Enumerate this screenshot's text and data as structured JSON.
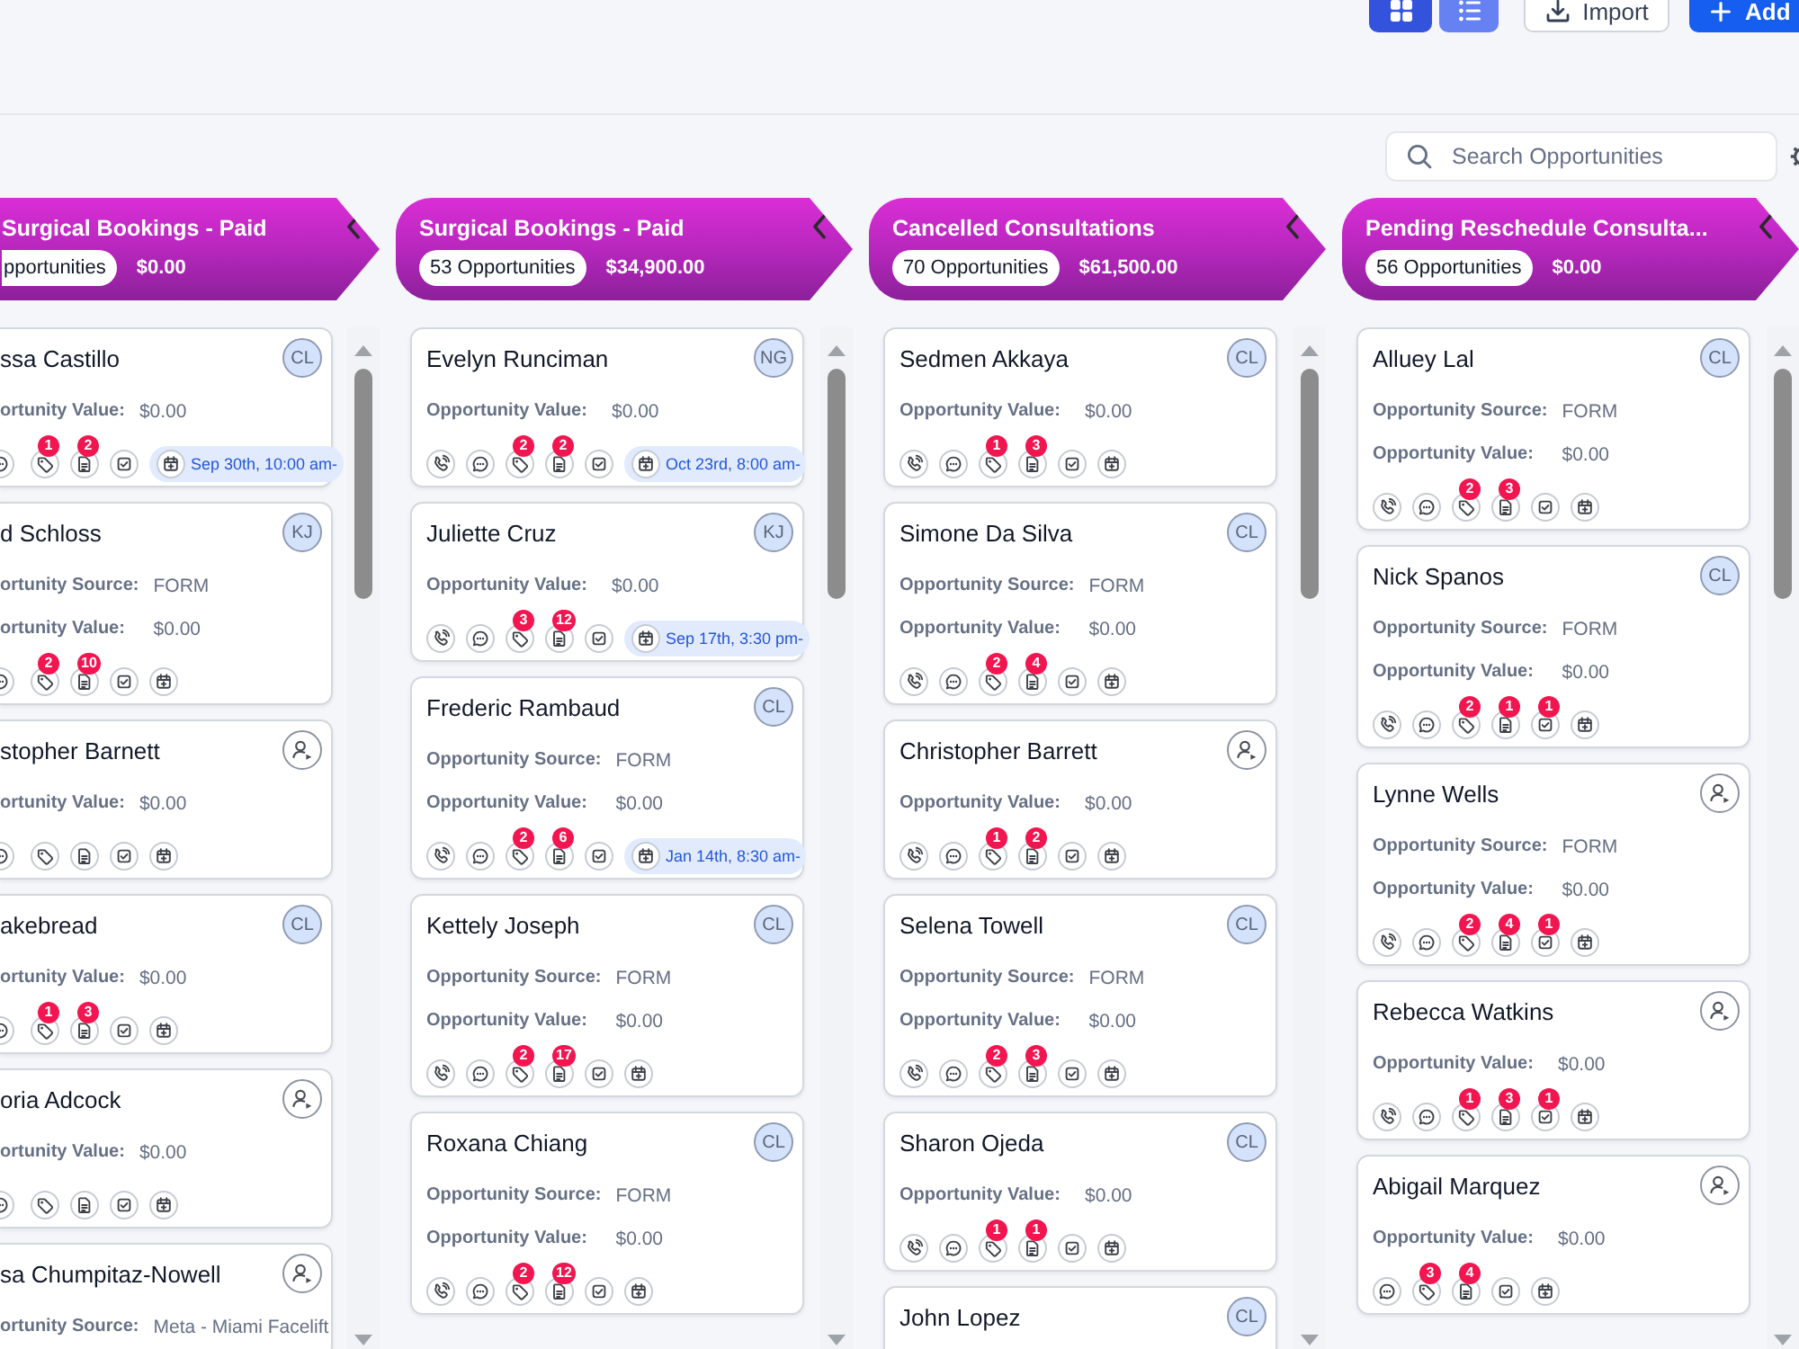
{
  "toolbar": {
    "view_toggle": [
      {
        "kind": "grid",
        "selected": true
      },
      {
        "kind": "list",
        "selected": false
      }
    ],
    "import_button": "Import",
    "add_button": "Add"
  },
  "search": {
    "placeholder": "Search Opportunities"
  },
  "stages": [
    {
      "title": "Surgical Bookings - Paid",
      "count": "pportunities",
      "total": "$0.00",
      "cards": [
        {
          "name": "ssa Castillo",
          "avatar": {
            "kind": "initials",
            "text": "CL"
          },
          "fields": [
            {
              "label": "ortunity Value:",
              "value": "$0.00"
            }
          ],
          "actions": [
            {
              "kind": "chat"
            },
            {
              "kind": "tag",
              "count": "1"
            },
            {
              "kind": "note",
              "count": "2"
            },
            {
              "kind": "task"
            },
            {
              "kind": "appointment",
              "date": "Sep 30th, 10:00 am-"
            }
          ]
        },
        {
          "name": "d Schloss",
          "avatar": {
            "kind": "initials",
            "text": "KJ"
          },
          "fields": [
            {
              "label": "ortunity Source:",
              "value": "FORM"
            },
            {
              "label": "ortunity Value:",
              "value": "$0.00"
            }
          ],
          "actions": [
            {
              "kind": "chat"
            },
            {
              "kind": "tag",
              "count": "2"
            },
            {
              "kind": "note",
              "count": "10"
            },
            {
              "kind": "task"
            },
            {
              "kind": "appointment"
            }
          ]
        },
        {
          "name": "stopher Barnett",
          "avatar": {
            "kind": "unassigned"
          },
          "fields": [
            {
              "label": "ortunity Value:",
              "value": "$0.00"
            }
          ],
          "actions": [
            {
              "kind": "chat"
            },
            {
              "kind": "tag"
            },
            {
              "kind": "note"
            },
            {
              "kind": "task"
            },
            {
              "kind": "appointment"
            }
          ]
        },
        {
          "name": "akebread",
          "avatar": {
            "kind": "initials",
            "text": "CL"
          },
          "fields": [
            {
              "label": "ortunity Value:",
              "value": "$0.00"
            }
          ],
          "actions": [
            {
              "kind": "chat"
            },
            {
              "kind": "tag",
              "count": "1"
            },
            {
              "kind": "note",
              "count": "3"
            },
            {
              "kind": "task"
            },
            {
              "kind": "appointment"
            }
          ]
        },
        {
          "name": "oria Adcock",
          "avatar": {
            "kind": "unassigned"
          },
          "fields": [
            {
              "label": "ortunity Value:",
              "value": "$0.00"
            }
          ],
          "actions": [
            {
              "kind": "chat"
            },
            {
              "kind": "tag"
            },
            {
              "kind": "note"
            },
            {
              "kind": "task"
            },
            {
              "kind": "appointment"
            }
          ]
        },
        {
          "name": "sa Chumpitaz-Nowell",
          "avatar": {
            "kind": "unassigned"
          },
          "fields": [
            {
              "label": "ortunity Source:",
              "value": "Meta - Miami Facelift"
            }
          ]
        }
      ]
    },
    {
      "title": "Surgical Bookings - Paid",
      "count": "53 Opportunities",
      "total": "$34,900.00",
      "cards": [
        {
          "name": "Evelyn Runciman",
          "avatar": {
            "kind": "initials",
            "text": "NG"
          },
          "fields": [
            {
              "label": "Opportunity Value:",
              "value": "$0.00"
            }
          ],
          "actions": [
            {
              "kind": "phone"
            },
            {
              "kind": "chat"
            },
            {
              "kind": "tag",
              "count": "2"
            },
            {
              "kind": "note",
              "count": "2"
            },
            {
              "kind": "task"
            },
            {
              "kind": "appointment",
              "date": "Oct 23rd, 8:00 am-"
            }
          ]
        },
        {
          "name": "Juliette Cruz",
          "avatar": {
            "kind": "initials",
            "text": "KJ"
          },
          "fields": [
            {
              "label": "Opportunity Value:",
              "value": "$0.00"
            }
          ],
          "actions": [
            {
              "kind": "phone"
            },
            {
              "kind": "chat"
            },
            {
              "kind": "tag",
              "count": "3"
            },
            {
              "kind": "note",
              "count": "12"
            },
            {
              "kind": "task"
            },
            {
              "kind": "appointment",
              "date": "Sep 17th, 3:30 pm-"
            }
          ]
        },
        {
          "name": "Frederic Rambaud",
          "avatar": {
            "kind": "initials",
            "text": "CL"
          },
          "fields": [
            {
              "label": "Opportunity Source:",
              "value": "FORM"
            },
            {
              "label": "Opportunity Value:",
              "value": "$0.00"
            }
          ],
          "actions": [
            {
              "kind": "phone"
            },
            {
              "kind": "chat"
            },
            {
              "kind": "tag",
              "count": "2"
            },
            {
              "kind": "note",
              "count": "6"
            },
            {
              "kind": "task"
            },
            {
              "kind": "appointment",
              "date": "Jan 14th, 8:30 am-"
            }
          ]
        },
        {
          "name": "Kettely Joseph",
          "avatar": {
            "kind": "initials",
            "text": "CL"
          },
          "fields": [
            {
              "label": "Opportunity Source:",
              "value": "FORM"
            },
            {
              "label": "Opportunity Value:",
              "value": "$0.00"
            }
          ],
          "actions": [
            {
              "kind": "phone"
            },
            {
              "kind": "chat"
            },
            {
              "kind": "tag",
              "count": "2"
            },
            {
              "kind": "note",
              "count": "17"
            },
            {
              "kind": "task"
            },
            {
              "kind": "appointment"
            }
          ]
        },
        {
          "name": "Roxana Chiang",
          "avatar": {
            "kind": "initials",
            "text": "CL"
          },
          "fields": [
            {
              "label": "Opportunity Source:",
              "value": "FORM"
            },
            {
              "label": "Opportunity Value:",
              "value": "$0.00"
            }
          ],
          "actions": [
            {
              "kind": "phone"
            },
            {
              "kind": "chat"
            },
            {
              "kind": "tag",
              "count": "2"
            },
            {
              "kind": "note",
              "count": "12"
            },
            {
              "kind": "task"
            },
            {
              "kind": "appointment"
            }
          ]
        }
      ]
    },
    {
      "title": "Cancelled Consultations",
      "count": "70 Opportunities",
      "total": "$61,500.00",
      "cards": [
        {
          "name": "Sedmen Akkaya",
          "avatar": {
            "kind": "initials",
            "text": "CL"
          },
          "fields": [
            {
              "label": "Opportunity Value:",
              "value": "$0.00"
            }
          ],
          "actions": [
            {
              "kind": "phone"
            },
            {
              "kind": "chat"
            },
            {
              "kind": "tag",
              "count": "1"
            },
            {
              "kind": "note",
              "count": "3"
            },
            {
              "kind": "task"
            },
            {
              "kind": "appointment"
            }
          ]
        },
        {
          "name": "Simone Da Silva",
          "avatar": {
            "kind": "initials",
            "text": "CL"
          },
          "fields": [
            {
              "label": "Opportunity Source:",
              "value": "FORM"
            },
            {
              "label": "Opportunity Value:",
              "value": "$0.00"
            }
          ],
          "actions": [
            {
              "kind": "phone"
            },
            {
              "kind": "chat"
            },
            {
              "kind": "tag",
              "count": "2"
            },
            {
              "kind": "note",
              "count": "4"
            },
            {
              "kind": "task"
            },
            {
              "kind": "appointment"
            }
          ]
        },
        {
          "name": "Christopher Barrett",
          "avatar": {
            "kind": "unassigned"
          },
          "fields": [
            {
              "label": "Opportunity Value:",
              "value": "$0.00"
            }
          ],
          "actions": [
            {
              "kind": "phone"
            },
            {
              "kind": "chat"
            },
            {
              "kind": "tag",
              "count": "1"
            },
            {
              "kind": "note",
              "count": "2"
            },
            {
              "kind": "task"
            },
            {
              "kind": "appointment"
            }
          ]
        },
        {
          "name": "Selena Towell",
          "avatar": {
            "kind": "initials",
            "text": "CL"
          },
          "fields": [
            {
              "label": "Opportunity Source:",
              "value": "FORM"
            },
            {
              "label": "Opportunity Value:",
              "value": "$0.00"
            }
          ],
          "actions": [
            {
              "kind": "phone"
            },
            {
              "kind": "chat"
            },
            {
              "kind": "tag",
              "count": "2"
            },
            {
              "kind": "note",
              "count": "3"
            },
            {
              "kind": "task"
            },
            {
              "kind": "appointment"
            }
          ]
        },
        {
          "name": "Sharon Ojeda",
          "avatar": {
            "kind": "initials",
            "text": "CL"
          },
          "fields": [
            {
              "label": "Opportunity Value:",
              "value": "$0.00"
            }
          ],
          "actions": [
            {
              "kind": "phone"
            },
            {
              "kind": "chat"
            },
            {
              "kind": "tag",
              "count": "1"
            },
            {
              "kind": "note",
              "count": "1"
            },
            {
              "kind": "task"
            },
            {
              "kind": "appointment"
            }
          ]
        },
        {
          "name": "John Lopez",
          "avatar": {
            "kind": "initials",
            "text": "CL"
          }
        }
      ]
    },
    {
      "title": "Pending Reschedule Consulta...",
      "count": "56 Opportunities",
      "total": "$0.00",
      "cards": [
        {
          "name": "Alluey Lal",
          "avatar": {
            "kind": "initials",
            "text": "CL"
          },
          "fields": [
            {
              "label": "Opportunity Source:",
              "value": "FORM"
            },
            {
              "label": "Opportunity Value:",
              "value": "$0.00"
            }
          ],
          "actions": [
            {
              "kind": "phone"
            },
            {
              "kind": "chat"
            },
            {
              "kind": "tag",
              "count": "2"
            },
            {
              "kind": "note",
              "count": "3"
            },
            {
              "kind": "task"
            },
            {
              "kind": "appointment"
            }
          ]
        },
        {
          "name": "Nick Spanos",
          "avatar": {
            "kind": "initials",
            "text": "CL"
          },
          "fields": [
            {
              "label": "Opportunity Source:",
              "value": "FORM"
            },
            {
              "label": "Opportunity Value:",
              "value": "$0.00"
            }
          ],
          "actions": [
            {
              "kind": "phone"
            },
            {
              "kind": "chat"
            },
            {
              "kind": "tag",
              "count": "2"
            },
            {
              "kind": "note",
              "count": "1"
            },
            {
              "kind": "task",
              "count": "1"
            },
            {
              "kind": "appointment"
            }
          ]
        },
        {
          "name": "Lynne Wells",
          "avatar": {
            "kind": "unassigned"
          },
          "fields": [
            {
              "label": "Opportunity Source:",
              "value": "FORM"
            },
            {
              "label": "Opportunity Value:",
              "value": "$0.00"
            }
          ],
          "actions": [
            {
              "kind": "phone"
            },
            {
              "kind": "chat"
            },
            {
              "kind": "tag",
              "count": "2"
            },
            {
              "kind": "note",
              "count": "4"
            },
            {
              "kind": "task",
              "count": "1"
            },
            {
              "kind": "appointment"
            }
          ]
        },
        {
          "name": "Rebecca Watkins",
          "avatar": {
            "kind": "unassigned"
          },
          "fields": [
            {
              "label": "Opportunity Value:",
              "value": "$0.00"
            }
          ],
          "actions": [
            {
              "kind": "phone"
            },
            {
              "kind": "chat"
            },
            {
              "kind": "tag",
              "count": "1"
            },
            {
              "kind": "note",
              "count": "3"
            },
            {
              "kind": "task",
              "count": "1"
            },
            {
              "kind": "appointment"
            }
          ]
        },
        {
          "name": "Abigail Marquez",
          "avatar": {
            "kind": "unassigned"
          },
          "fields": [
            {
              "label": "Opportunity Value:",
              "value": "$0.00"
            }
          ],
          "actions": [
            {
              "kind": "chat"
            },
            {
              "kind": "tag",
              "count": "3"
            },
            {
              "kind": "note",
              "count": "4"
            },
            {
              "kind": "task"
            },
            {
              "kind": "appointment"
            }
          ]
        }
      ]
    }
  ]
}
